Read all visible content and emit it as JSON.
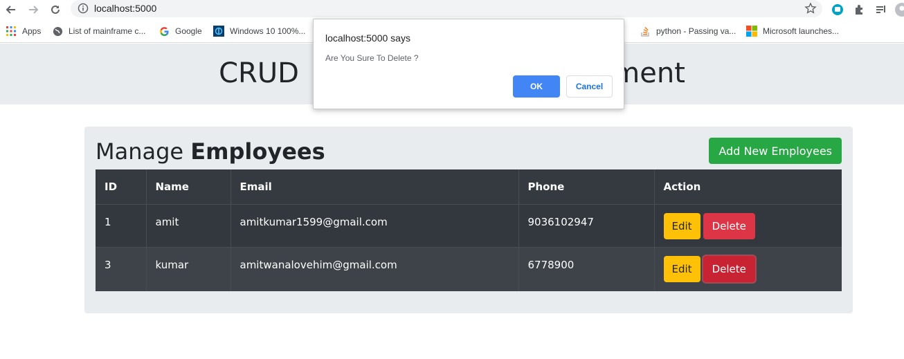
{
  "browser": {
    "url": "localhost:5000",
    "bookmarks": [
      {
        "label": "Apps",
        "icon": "apps-grid-icon"
      },
      {
        "label": "List of mainframe c...",
        "icon": "globe-icon"
      },
      {
        "label": "Google",
        "icon": "google-icon"
      },
      {
        "label": "Windows 10 100%...",
        "icon": "windows-site-icon"
      },
      {
        "label": "python - Passing va...",
        "icon": "stackoverflow-icon"
      },
      {
        "label": "Microsoft launches...",
        "icon": "microsoft-icon"
      }
    ]
  },
  "page": {
    "header_title_left": "CRUD",
    "header_title_right": "pment",
    "manage_prefix": "Manage",
    "manage_strong": "Employees",
    "add_button": "Add New Employees",
    "table": {
      "headers": [
        "ID",
        "Name",
        "Email",
        "Phone",
        "Action"
      ],
      "rows": [
        {
          "id": "1",
          "name": "amit",
          "email": "amitkumar1599@gmail.com",
          "phone": "9036102947",
          "edit": "Edit",
          "delete": "Delete"
        },
        {
          "id": "3",
          "name": "kumar",
          "email": "amitwanalovehim@gmail.com",
          "phone": "6778900",
          "edit": "Edit",
          "delete": "Delete"
        }
      ]
    }
  },
  "dialog": {
    "title": "localhost:5000 says",
    "message": "Are You Sure To Delete ?",
    "ok": "OK",
    "cancel": "Cancel"
  },
  "colors": {
    "success": "#28a745",
    "warning": "#ffc107",
    "danger": "#dc3545",
    "table_dark": "#343a40",
    "dialog_ok": "#4285f4"
  }
}
